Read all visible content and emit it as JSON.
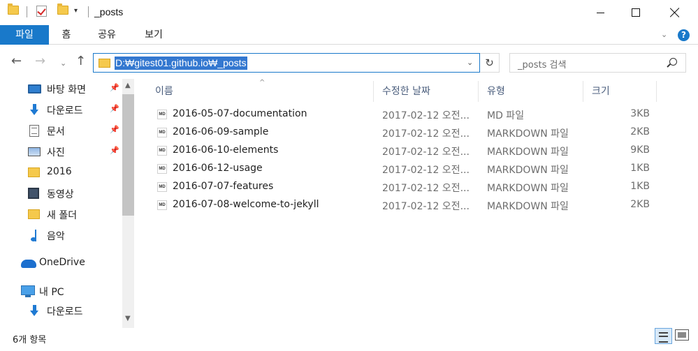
{
  "window": {
    "title": "_posts",
    "qat_separator": "|",
    "dropdown_glyph": "▾",
    "minimize_label": "",
    "maximize_label": "",
    "close_label": ""
  },
  "ribbon": {
    "tabs": [
      "파일",
      "홈",
      "공유",
      "보기"
    ],
    "expand_glyph": "⌄",
    "help_glyph": "?",
    "accent_color": "#1979ca"
  },
  "nav": {
    "back_glyph": "←",
    "forward_glyph": "→",
    "recent_glyph": "⌄",
    "up_glyph": "↑",
    "address": "D:₩gitest01.github.io₩_posts",
    "address_dropdown_glyph": "⌄",
    "refresh_glyph": "↻",
    "search_placeholder": "_posts 검색"
  },
  "sidebar": {
    "items": [
      {
        "label": "바탕 화면",
        "icon": "desktop-icon",
        "pinned": true
      },
      {
        "label": "다운로드",
        "icon": "download-icon",
        "pinned": true
      },
      {
        "label": "문서",
        "icon": "document-icon",
        "pinned": true
      },
      {
        "label": "사진",
        "icon": "pictures-icon",
        "pinned": true
      },
      {
        "label": "2016",
        "icon": "folder-icon",
        "pinned": false
      },
      {
        "label": "동영상",
        "icon": "video-icon",
        "pinned": false
      },
      {
        "label": "새 폴더",
        "icon": "folder-icon",
        "pinned": false
      },
      {
        "label": "음악",
        "icon": "music-icon",
        "pinned": false
      }
    ],
    "onedrive": "OneDrive",
    "this_pc": "내 PC",
    "pc_downloads": "다운로드",
    "pin_glyph": "📌",
    "scroll_up_glyph": "▲",
    "scroll_down_glyph": "▼"
  },
  "filelist": {
    "sort_glyph": "^",
    "columns": {
      "name": "이름",
      "date": "수정한 날짜",
      "type": "유형",
      "size": "크기"
    },
    "icon_text": "MD",
    "rows": [
      {
        "name": "2016-05-07-documentation",
        "date": "2017-02-12 오전...",
        "type": "MD 파일",
        "size": "3KB"
      },
      {
        "name": "2016-06-09-sample",
        "date": "2017-02-12 오전...",
        "type": "MARKDOWN 파일",
        "size": "2KB"
      },
      {
        "name": "2016-06-10-elements",
        "date": "2017-02-12 오전...",
        "type": "MARKDOWN 파일",
        "size": "9KB"
      },
      {
        "name": "2016-06-12-usage",
        "date": "2017-02-12 오전...",
        "type": "MARKDOWN 파일",
        "size": "1KB"
      },
      {
        "name": "2016-07-07-features",
        "date": "2017-02-12 오전...",
        "type": "MARKDOWN 파일",
        "size": "1KB"
      },
      {
        "name": "2016-07-08-welcome-to-jekyll",
        "date": "2017-02-12 오전...",
        "type": "MARKDOWN 파일",
        "size": "2KB"
      }
    ]
  },
  "status": {
    "item_count": "6개 항목"
  }
}
